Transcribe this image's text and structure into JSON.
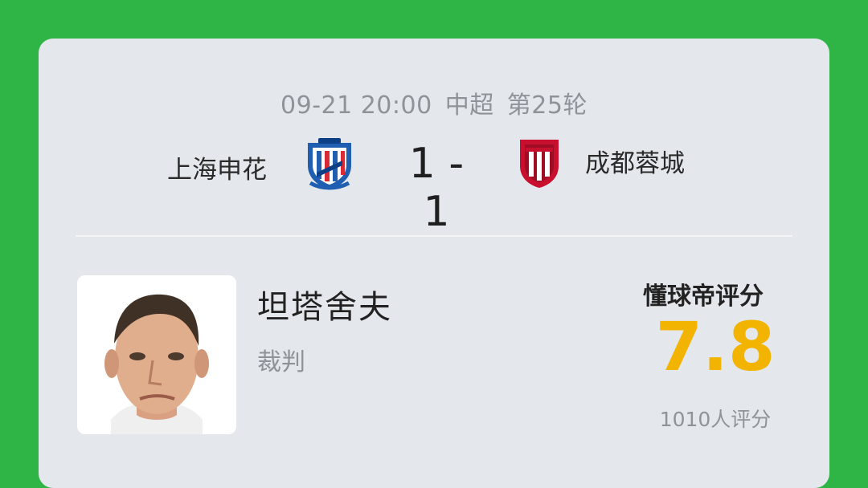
{
  "match": {
    "date_time": "09-21 20:00",
    "league": "中超",
    "round": "第25轮",
    "home_team": "上海申花",
    "away_team": "成都蓉城",
    "score": "1 - 1"
  },
  "referee": {
    "name": "坦塔舍夫",
    "role": "裁判"
  },
  "rating": {
    "label": "懂球帝评分",
    "value": "7.8",
    "count": "1010人评分"
  },
  "colors": {
    "background": "#2fb545",
    "card": "#e4e7ec",
    "rating": "#f2b400"
  },
  "icons": {
    "home_logo": "shanghai-shenhua-crest-icon",
    "away_logo": "chengdu-rongcheng-crest-icon"
  }
}
